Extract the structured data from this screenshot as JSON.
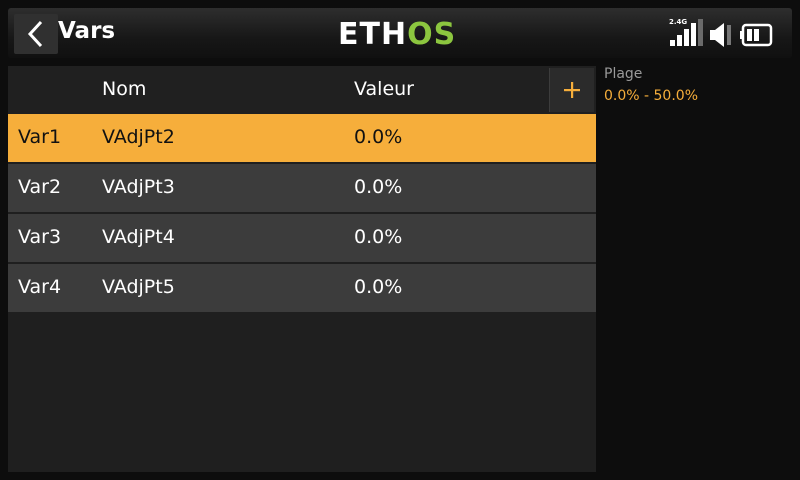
{
  "header": {
    "title": "Vars",
    "logo_part1": "ETH",
    "logo_part2": "OS",
    "signal_band": "2.4G"
  },
  "table": {
    "columns": [
      "Nom",
      "Valeur"
    ],
    "add_icon": "plus-icon",
    "rows": [
      {
        "id": "Var1",
        "name": "VAdjPt2",
        "value": "0.0%"
      },
      {
        "id": "Var2",
        "name": "VAdjPt3",
        "value": "0.0%"
      },
      {
        "id": "Var3",
        "name": "VAdjPt4",
        "value": "0.0%"
      },
      {
        "id": "Var4",
        "name": "VAdjPt5",
        "value": "0.0%"
      }
    ],
    "selected_row": 0
  },
  "info": {
    "label": "Plage",
    "value": "0.0% - 50.0%"
  },
  "colors": {
    "accent": "#f6ae3b",
    "logo_green": "#8cc63f",
    "row_bg": "#3c3c3c"
  }
}
